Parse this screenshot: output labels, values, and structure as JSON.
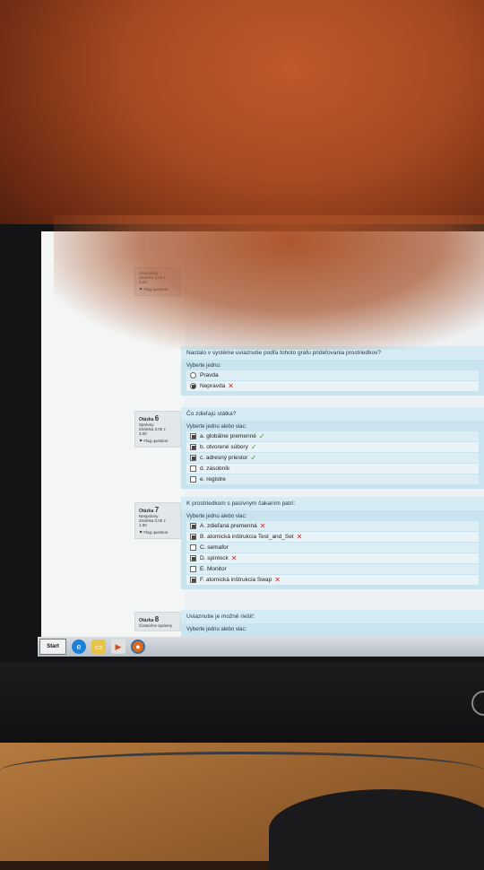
{
  "quiz": {
    "partial_top": {
      "info_lines": [
        "Nesprávny",
        "Známka 0,00 z",
        "0,00"
      ],
      "flag_label": "Flag question",
      "question_text": "Nastalo v systéme uviaznutie podľa tohoto grafu prideľovania prostriedkov?",
      "answer_prompt": "Vyberte jednu:",
      "options": [
        {
          "label": "Pravda",
          "checked": false,
          "mark": ""
        },
        {
          "label": "Nepravda",
          "checked": true,
          "mark": "cross"
        }
      ]
    },
    "questions": [
      {
        "number_label": "Otázka",
        "number": "6",
        "status": "Správny",
        "grade_line1": "Známka 3,00 z",
        "grade_line2": "3,00",
        "flag_label": "Flag question",
        "question_text": "Čo zdieľajú státka?",
        "answer_prompt": "Vyberte jednu alebo viac:",
        "options": [
          {
            "label": "a. globálne premenné",
            "checked": true,
            "mark": "check"
          },
          {
            "label": "b. otvorené súbory",
            "checked": true,
            "mark": "check"
          },
          {
            "label": "c. adresný priestor",
            "checked": true,
            "mark": "check"
          },
          {
            "label": "d. zásobník",
            "checked": false,
            "mark": ""
          },
          {
            "label": "e. registre",
            "checked": false,
            "mark": ""
          }
        ]
      },
      {
        "number_label": "Otázka",
        "number": "7",
        "status": "Nesprávny",
        "grade_line1": "Známka 0,00 z",
        "grade_line2": "1,00",
        "flag_label": "Flag question",
        "question_text": "K prostriedkom s pasívnym čakaním patrí:",
        "answer_prompt": "Vyberte jednu alebo viac:",
        "options": [
          {
            "label": "A. zdieľaná premenná",
            "checked": true,
            "mark": "cross"
          },
          {
            "label": "B. atomická inštrukcia Test_and_Set",
            "checked": true,
            "mark": "cross"
          },
          {
            "label": "C. semafor",
            "checked": false,
            "mark": ""
          },
          {
            "label": "D. spinlock",
            "checked": true,
            "mark": "cross"
          },
          {
            "label": "E. Monitor",
            "checked": false,
            "mark": ""
          },
          {
            "label": "F. atomická inštrukcia Swap",
            "checked": true,
            "mark": "cross"
          }
        ]
      },
      {
        "number_label": "Otázka",
        "number": "8",
        "status": "Čiastočne správny",
        "question_text": "Uviaznutie je možné riešiť:",
        "answer_prompt": "Vyberte jednu alebo viac:"
      }
    ]
  },
  "taskbar": {
    "start_label": "Start",
    "icons": [
      "internet-explorer-icon",
      "folder-icon",
      "media-player-icon",
      "firefox-icon"
    ]
  },
  "colors": {
    "correct": "#3a9a2a",
    "incorrect": "#d8241d",
    "answer_bg": "#d5ecf5"
  }
}
